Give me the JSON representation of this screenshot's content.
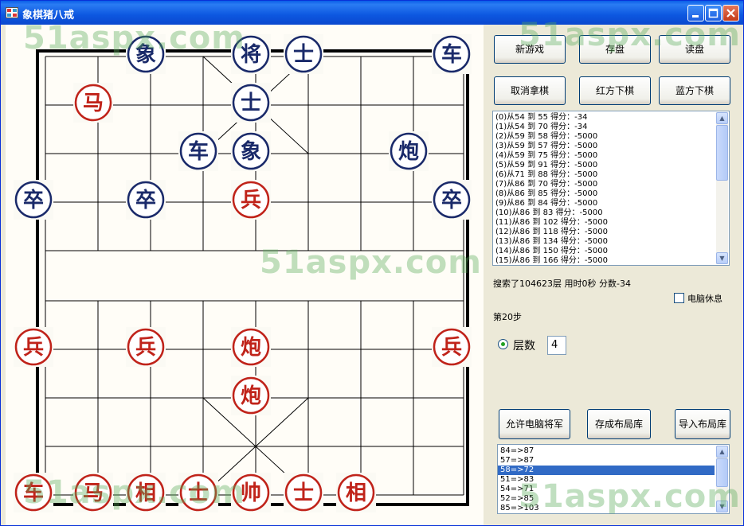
{
  "window": {
    "title": "象棋猪八戒"
  },
  "watermark_text": "51aspx.com",
  "colors": {
    "red": "#c0231a",
    "blue": "#1a2a6a",
    "board_line": "#000000",
    "selection": "#316ac5"
  },
  "board": {
    "pieces": [
      {
        "char": "象",
        "side": "blue",
        "col": 2,
        "row": 0
      },
      {
        "char": "将",
        "side": "blue",
        "col": 4,
        "row": 0
      },
      {
        "char": "士",
        "side": "blue",
        "col": 5,
        "row": 0
      },
      {
        "char": "车",
        "side": "blue",
        "col": 8,
        "row": 0
      },
      {
        "char": "马",
        "side": "red",
        "col": 1,
        "row": 1
      },
      {
        "char": "士",
        "side": "blue",
        "col": 4,
        "row": 1
      },
      {
        "char": "车",
        "side": "blue",
        "col": 3,
        "row": 2
      },
      {
        "char": "象",
        "side": "blue",
        "col": 4,
        "row": 2
      },
      {
        "char": "炮",
        "side": "blue",
        "col": 7,
        "row": 2
      },
      {
        "char": "卒",
        "side": "blue",
        "col": 0,
        "row": 3
      },
      {
        "char": "卒",
        "side": "blue",
        "col": 2,
        "row": 3
      },
      {
        "char": "兵",
        "side": "red",
        "col": 4,
        "row": 3
      },
      {
        "char": "卒",
        "side": "blue",
        "col": 8,
        "row": 3
      },
      {
        "char": "兵",
        "side": "red",
        "col": 0,
        "row": 6
      },
      {
        "char": "兵",
        "side": "red",
        "col": 2,
        "row": 6
      },
      {
        "char": "炮",
        "side": "red",
        "col": 4,
        "row": 6
      },
      {
        "char": "兵",
        "side": "red",
        "col": 8,
        "row": 6
      },
      {
        "char": "炮",
        "side": "red",
        "col": 4,
        "row": 7
      },
      {
        "char": "车",
        "side": "red",
        "col": 0,
        "row": 9
      },
      {
        "char": "马",
        "side": "red",
        "col": 1,
        "row": 9
      },
      {
        "char": "相",
        "side": "red",
        "col": 2,
        "row": 9
      },
      {
        "char": "士",
        "side": "red",
        "col": 3,
        "row": 9
      },
      {
        "char": "帅",
        "side": "red",
        "col": 4,
        "row": 9
      },
      {
        "char": "士",
        "side": "red",
        "col": 5,
        "row": 9
      },
      {
        "char": "相",
        "side": "red",
        "col": 6,
        "row": 9
      }
    ]
  },
  "buttons": {
    "new_game": "新游戏",
    "save": "存盘",
    "load": "读盘",
    "undo": "取消拿棋",
    "red_move": "红方下棋",
    "blue_move": "蓝方下棋",
    "allow_check": "允许电脑将军",
    "save_layout": "存成布局库",
    "import_layout": "导入布局库"
  },
  "search_list": [
    "(0)从54  到  55  得分：-34",
    "(1)从54  到  70  得分：-34",
    "(2)从59  到  58  得分：-5000",
    "(3)从59  到  57  得分：-5000",
    "(4)从59  到  75  得分：-5000",
    "(5)从59  到  91  得分：-5000",
    "(6)从71  到  88  得分：-5000",
    "(7)从86  到  70  得分：-5000",
    "(8)从86  到  85  得分：-5000",
    "(9)从86  到  84  得分：-5000",
    "(10)从86  到  83  得分：-5000",
    "(11)从86  到  102  得分：-5000",
    "(12)从86  到  118  得分：-5000",
    "(13)从86  到  134  得分：-5000",
    "(14)从86  到  150  得分：-5000",
    "(15)从86  到  166  得分：-5000"
  ],
  "status": {
    "search_info": "搜索了104623层    用时0秒  分数-34",
    "computer_rest": "电脑休息",
    "step": "第20步",
    "depth_label": "层数",
    "depth_value": "4"
  },
  "moves_list": [
    "84=>87",
    "57=>87",
    "58=>72",
    "51=>83",
    "54=>71",
    "52=>85",
    "85=>103"
  ],
  "moves_selected_index": 2
}
